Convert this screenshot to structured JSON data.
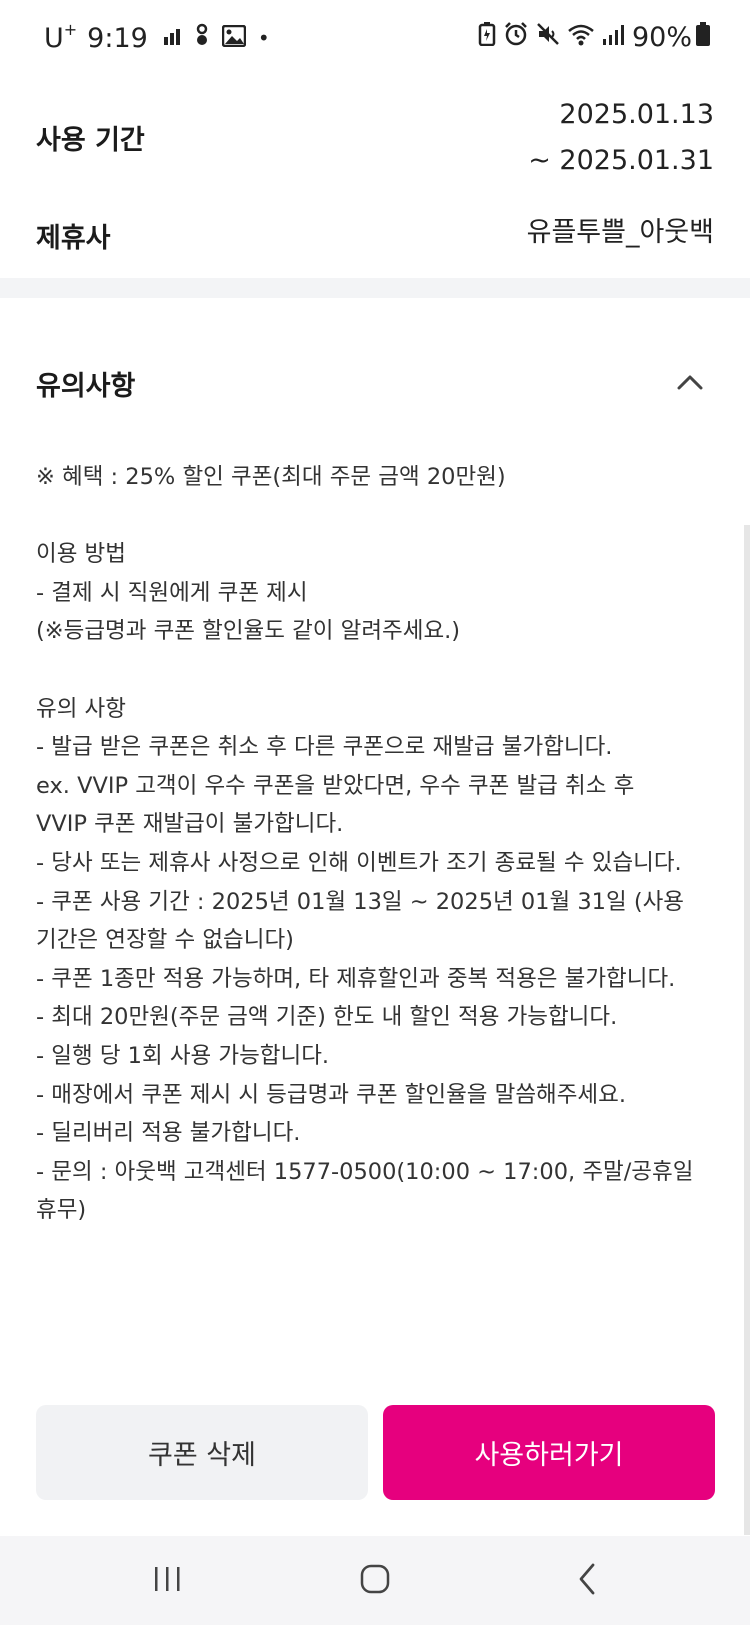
{
  "status_bar": {
    "carrier": "U",
    "carrier_sup": "+",
    "time": "9:19",
    "dot": "•",
    "battery_percent": "90%"
  },
  "usage_period": {
    "label": "사용 기간",
    "start": "2025.01.13",
    "end": "~ 2025.01.31"
  },
  "partner": {
    "label": "제휴사",
    "value": "유플투쁠_아웃백"
  },
  "notice": {
    "title": "유의사항",
    "lines": [
      "※ 혜택 : 25% 할인 쿠폰(최대 주문 금액 20만원)",
      "",
      "이용 방법",
      "- 결제 시 직원에게 쿠폰 제시",
      "(※등급명과 쿠폰 할인율도 같이 알려주세요.)",
      "",
      "유의 사항",
      "- 발급 받은 쿠폰은 취소 후 다른 쿠폰으로 재발급 불가합니다.",
      "ex. VVIP 고객이 우수 쿠폰을 받았다면, 우수 쿠폰 발급 취소 후",
      "VVIP 쿠폰 재발급이 불가합니다.",
      "- 당사 또는 제휴사 사정으로 인해 이벤트가 조기 종료될 수 있습니다.",
      "- 쿠폰 사용 기간 : 2025년 01월 13일 ~ 2025년 01월 31일 (사용",
      "기간은 연장할 수 없습니다)",
      "- 쿠폰 1종만 적용 가능하며, 타 제휴할인과 중복 적용은 불가합니다.",
      "- 최대 20만원(주문 금액 기준) 한도 내 할인 적용 가능합니다.",
      "- 일행 당 1회 사용 가능합니다.",
      "- 매장에서 쿠폰 제시 시 등급명과 쿠폰 할인율을 말씀해주세요.",
      "- 딜리버리 적용 불가합니다.",
      "- 문의 : 아웃백 고객센터 1577-0500(10:00 ~ 17:00, 주말/공휴일",
      "휴무)"
    ]
  },
  "buttons": {
    "delete": "쿠폰 삭제",
    "use": "사용하러가기"
  },
  "colors": {
    "accent": "#e6007e",
    "secondary_button": "#f1f2f4",
    "divider": "#f3f4f6"
  },
  "icons": {
    "collapse": "chevron-up-icon",
    "nav_recents": "recent-apps-icon",
    "nav_home": "home-icon",
    "nav_back": "back-icon"
  }
}
